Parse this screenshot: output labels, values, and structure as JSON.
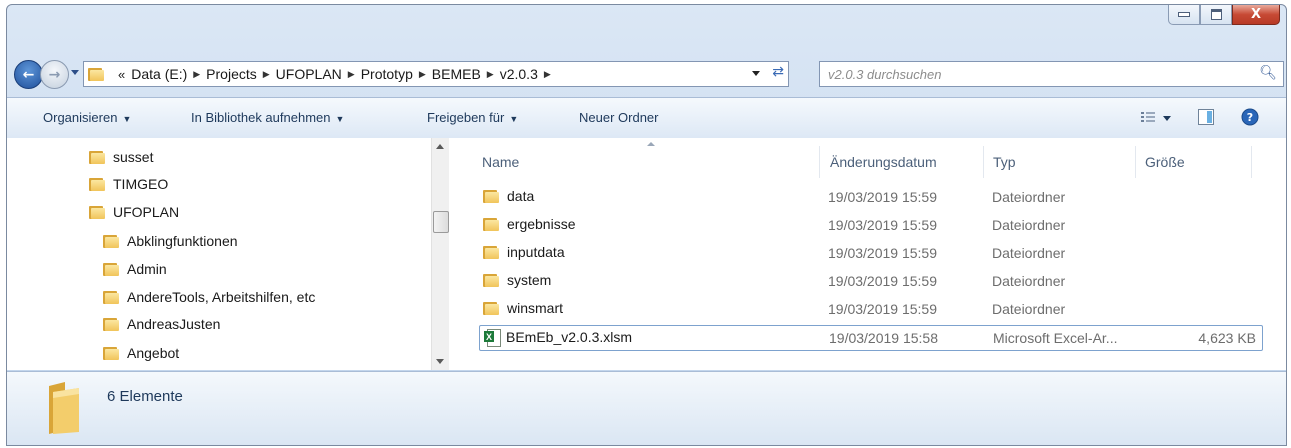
{
  "window": {
    "minimize_icon": "minimize-icon",
    "maximize_icon": "maximize-icon",
    "close_label": "X"
  },
  "nav": {
    "breadcrumb_overflow": "«",
    "breadcrumbs": [
      "Data (E:)",
      "Projects",
      "UFOPLAN",
      "Prototyp",
      "BEMEB",
      "v2.0.3"
    ],
    "search_placeholder": "v2.0.3 durchsuchen"
  },
  "toolbar": {
    "organize": "Organisieren",
    "library": "In Bibliothek aufnehmen",
    "share": "Freigeben für",
    "new_folder": "Neuer Ordner"
  },
  "tree": {
    "items": [
      {
        "label": "susset",
        "level": 0
      },
      {
        "label": "TIMGEO",
        "level": 0
      },
      {
        "label": "UFOPLAN",
        "level": 0
      },
      {
        "label": "Abklingfunktionen",
        "level": 1
      },
      {
        "label": "Admin",
        "level": 1
      },
      {
        "label": "AndereTools, Arbeitshilfen, etc",
        "level": 1
      },
      {
        "label": "AndreasJusten",
        "level": 1
      },
      {
        "label": "Angebot",
        "level": 1
      }
    ]
  },
  "list": {
    "columns": {
      "name": "Name",
      "date": "Änderungsdatum",
      "type": "Typ",
      "size": "Größe"
    },
    "rows": [
      {
        "name": "data",
        "date": "19/03/2019 15:59",
        "type": "Dateiordner",
        "size": "",
        "icon": "folder-icon"
      },
      {
        "name": "ergebnisse",
        "date": "19/03/2019 15:59",
        "type": "Dateiordner",
        "size": "",
        "icon": "folder-icon"
      },
      {
        "name": "inputdata",
        "date": "19/03/2019 15:59",
        "type": "Dateiordner",
        "size": "",
        "icon": "folder-icon"
      },
      {
        "name": "system",
        "date": "19/03/2019 15:59",
        "type": "Dateiordner",
        "size": "",
        "icon": "folder-icon"
      },
      {
        "name": "winsmart",
        "date": "19/03/2019 15:59",
        "type": "Dateiordner",
        "size": "",
        "icon": "folder-icon"
      },
      {
        "name": "BEmEb_v2.0.3.xlsm",
        "date": "19/03/2019 15:58",
        "type": "Microsoft Excel-Ar...",
        "size": "4,623 KB",
        "icon": "excel-file-icon"
      }
    ]
  },
  "status": {
    "count": "6 Elemente"
  }
}
